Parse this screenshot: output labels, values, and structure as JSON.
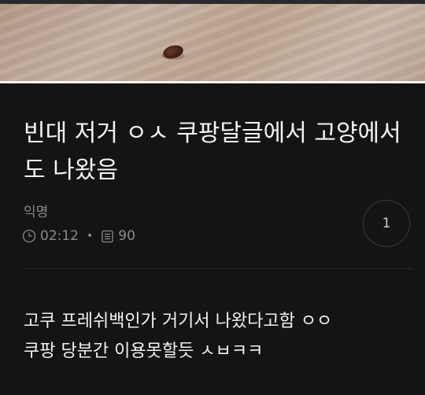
{
  "post": {
    "title": "빈대 저거 ㅇㅅ 쿠팡달글에서 고양에서도 나왔음",
    "author": "익명",
    "time": "02:12",
    "views": "90",
    "comment_count": "1",
    "body_lines": [
      "고쿠 프레쉬백인가 거기서 나왔다고함 ㅇㅇ",
      "쿠팡 당분간 이용못할듯 ㅅㅂㅋㅋ"
    ]
  },
  "icons": {
    "time": "clock-icon",
    "views": "document-icon"
  },
  "colors": {
    "background": "#141414",
    "text": "#f4f4f4",
    "muted": "#8a8a8a"
  }
}
